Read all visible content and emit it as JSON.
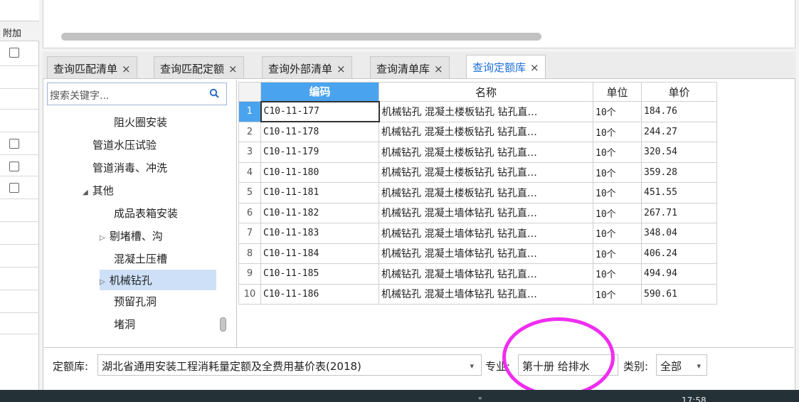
{
  "left_column": {
    "header": "附加",
    "checkbox_rows": [
      true,
      false,
      false,
      false,
      true,
      true,
      true,
      false,
      false,
      false,
      false,
      false,
      false
    ]
  },
  "tabs": [
    {
      "label": "查询匹配清单",
      "close": "×",
      "active": false
    },
    {
      "label": "查询匹配定额",
      "close": "×",
      "active": false
    },
    {
      "label": "查询外部清单",
      "close": "×",
      "active": false
    },
    {
      "label": "查询清单库",
      "close": "×",
      "active": false
    },
    {
      "label": "查询定额库",
      "close": "×",
      "active": true
    }
  ],
  "search": {
    "placeholder": "搜索关键字...",
    "icon": "search-icon"
  },
  "tree": [
    {
      "label": "阻火圈安装",
      "expander": ""
    },
    {
      "label": "管道水压试验",
      "expander": ""
    },
    {
      "label": "管道消毒、冲洗",
      "expander": ""
    },
    {
      "label": "其他",
      "expander": "◢"
    },
    {
      "label": "成品表箱安装",
      "expander": ""
    },
    {
      "label": "剔堵槽、沟",
      "expander": "▷"
    },
    {
      "label": "混凝土压槽",
      "expander": ""
    },
    {
      "label": "机械钻孔",
      "expander": "▷",
      "selected": true
    },
    {
      "label": "预留孔洞",
      "expander": ""
    },
    {
      "label": "堵洞",
      "expander": ""
    }
  ],
  "table": {
    "headers": {
      "code": "编码",
      "name": "名称",
      "unit": "单位",
      "price": "单价"
    },
    "rows": [
      {
        "n": "1",
        "code": "C10-11-177",
        "name": "机械钻孔 混凝土楼板钻孔 钻孔直…",
        "unit": "10个",
        "price": "184.76"
      },
      {
        "n": "2",
        "code": "C10-11-178",
        "name": "机械钻孔 混凝土楼板钻孔 钻孔直…",
        "unit": "10个",
        "price": "244.27"
      },
      {
        "n": "3",
        "code": "C10-11-179",
        "name": "机械钻孔 混凝土楼板钻孔 钻孔直…",
        "unit": "10个",
        "price": "320.54"
      },
      {
        "n": "4",
        "code": "C10-11-180",
        "name": "机械钻孔 混凝土楼板钻孔 钻孔直…",
        "unit": "10个",
        "price": "359.28"
      },
      {
        "n": "5",
        "code": "C10-11-181",
        "name": "机械钻孔 混凝土楼板钻孔 钻孔直…",
        "unit": "10个",
        "price": "451.55"
      },
      {
        "n": "6",
        "code": "C10-11-182",
        "name": "机械钻孔 混凝土墙体钻孔 钻孔直…",
        "unit": "10个",
        "price": "267.71"
      },
      {
        "n": "7",
        "code": "C10-11-183",
        "name": "机械钻孔 混凝土墙体钻孔 钻孔直…",
        "unit": "10个",
        "price": "348.04"
      },
      {
        "n": "8",
        "code": "C10-11-184",
        "name": "机械钻孔 混凝土墙体钻孔 钻孔直…",
        "unit": "10个",
        "price": "406.24"
      },
      {
        "n": "9",
        "code": "C10-11-185",
        "name": "机械钻孔 混凝土墙体钻孔 钻孔直…",
        "unit": "10个",
        "price": "494.94"
      },
      {
        "n": "10",
        "code": "C10-11-186",
        "name": "机械钻孔 混凝土墙体钻孔 钻孔直…",
        "unit": "10个",
        "price": "590.61"
      }
    ]
  },
  "bottom_bar": {
    "library_label": "定额库:",
    "library_value": "湖北省通用安装工程消耗量定额及全费用基价表(2018)",
    "specialty_label": "专业:",
    "specialty_value": "第十册 给排水",
    "category_label": "类别:",
    "category_value": "全部",
    "caret": "▾"
  },
  "taskbar": {
    "clock": "17:58",
    "mark": "\""
  },
  "colors": {
    "accent": "#4aa3ef",
    "tab_active_text": "#1c6ed8",
    "highlight_ellipse": "#f02df0",
    "tree_selected": "#cde0f7"
  }
}
